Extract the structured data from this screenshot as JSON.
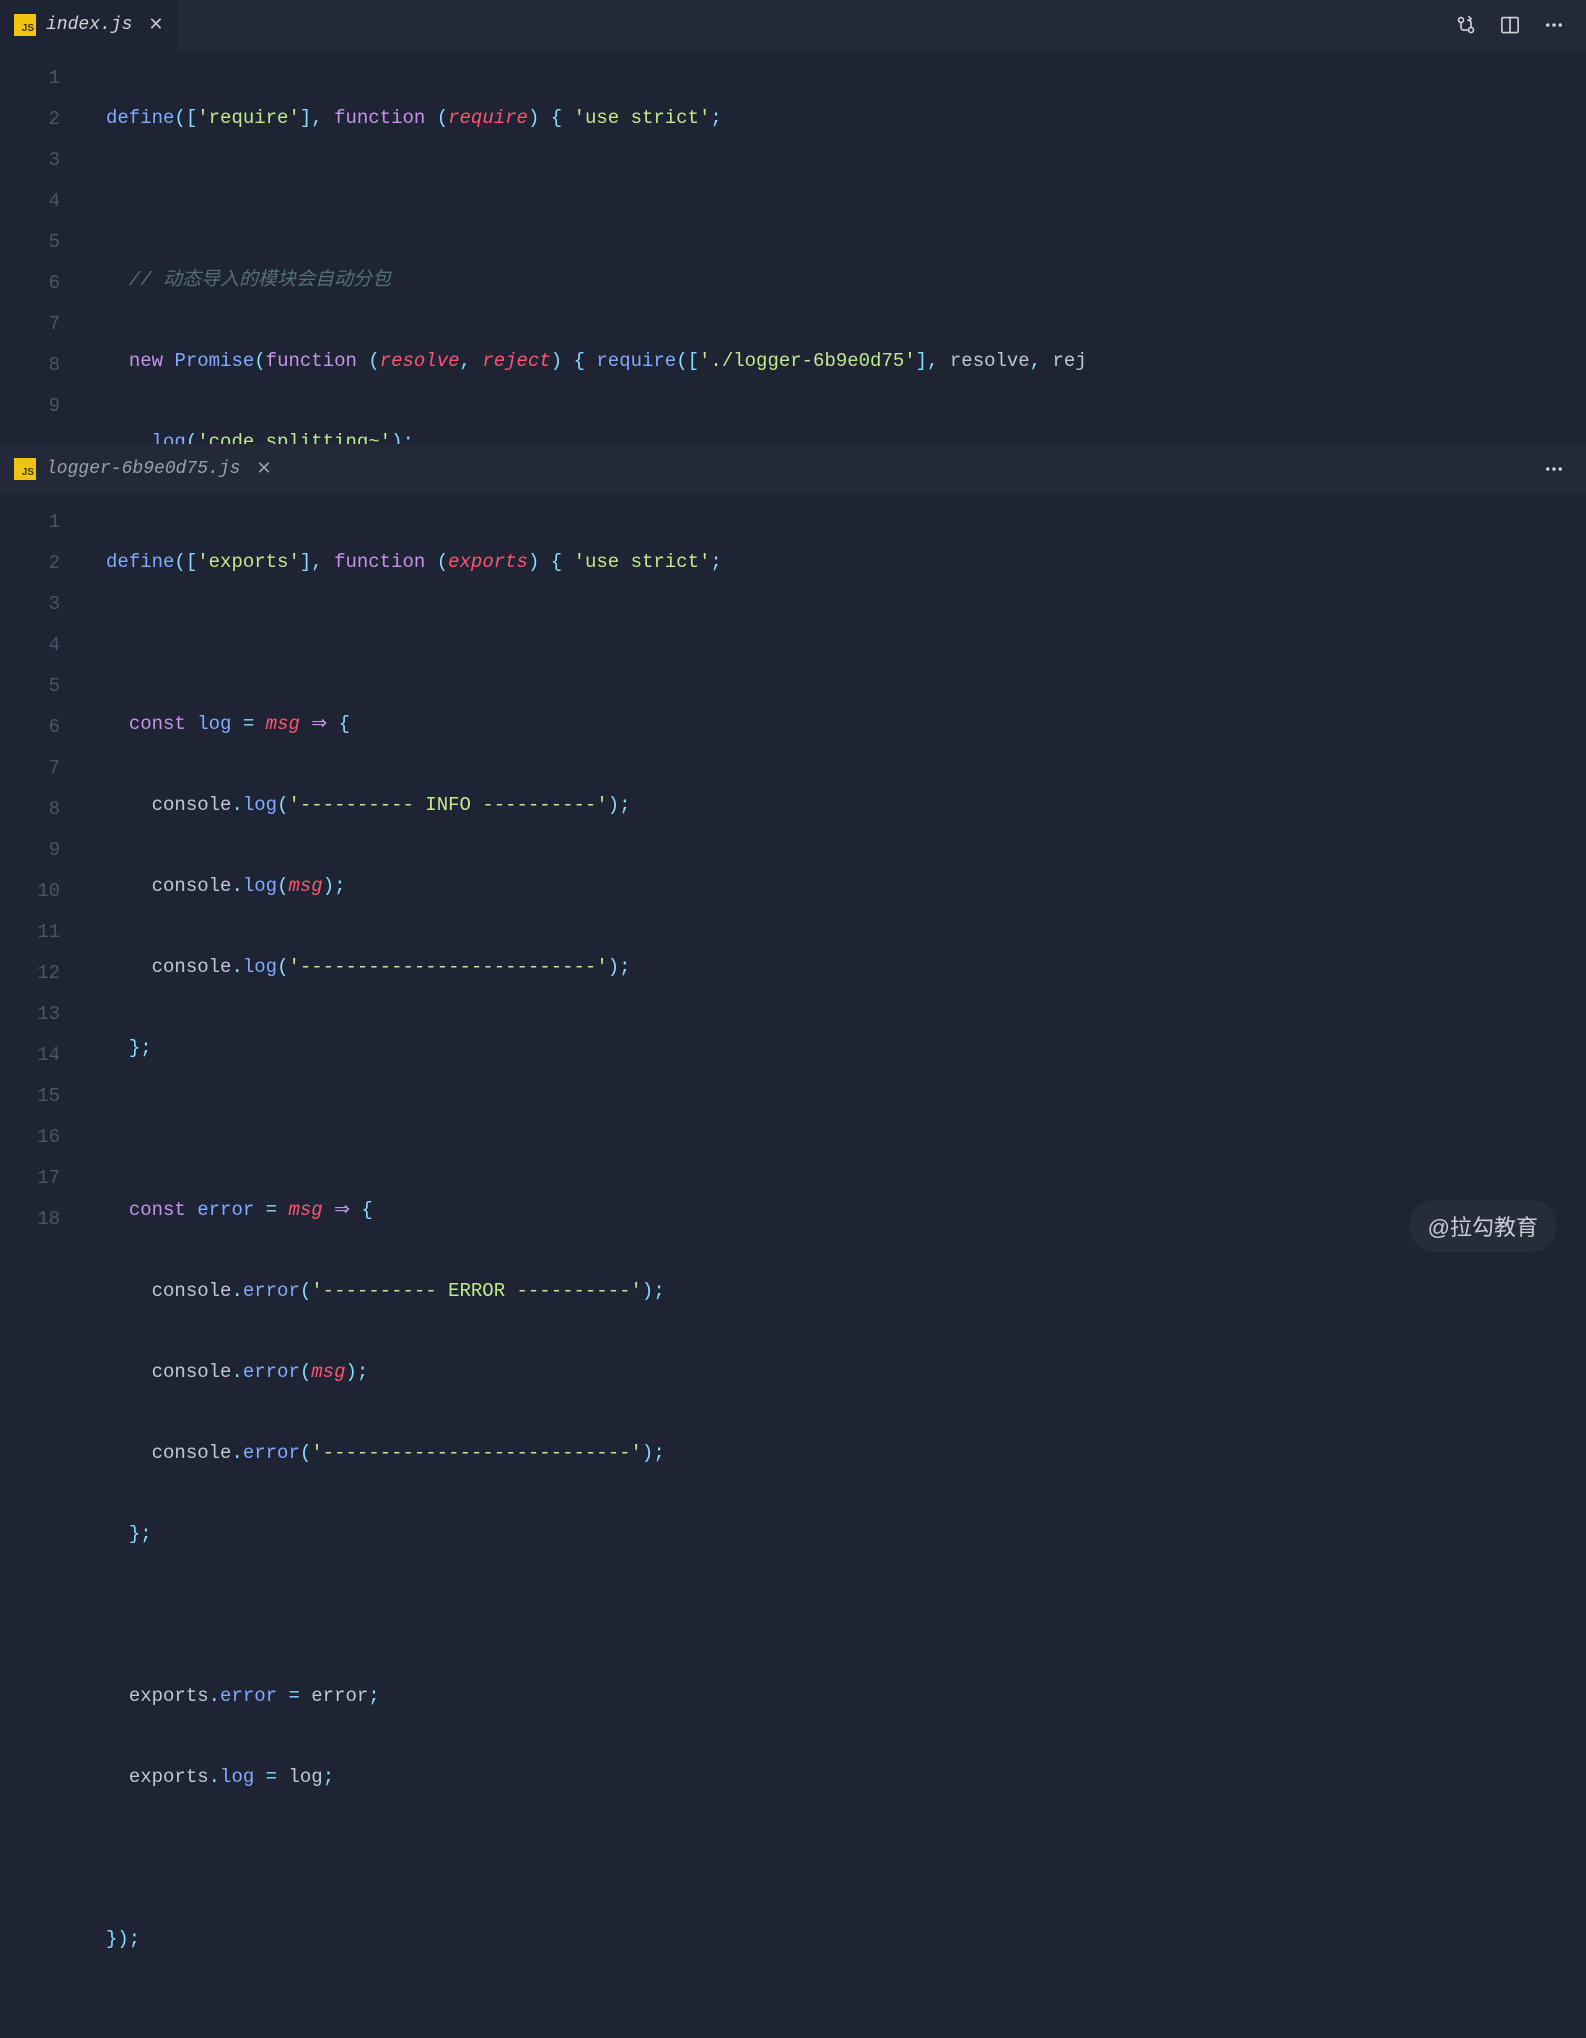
{
  "pane1": {
    "tab": {
      "filename": "index.js",
      "badge": "JS"
    },
    "actions": {
      "compare": "compare-changes-icon",
      "split": "split-editor-icon",
      "more": "more-icon"
    },
    "lines": [
      "1",
      "2",
      "3",
      "4",
      "5",
      "6",
      "7",
      "8",
      "9"
    ],
    "code": {
      "l1_define": "define",
      "l1_req_str": "'require'",
      "l1_function": "function",
      "l1_param": "require",
      "l1_usestrict": "'use strict'",
      "l3_comment": "// 动态导入的模块会自动分包",
      "l4_new": "new",
      "l4_promise": "Promise",
      "l4_function": "function",
      "l4_resolve": "resolve",
      "l4_reject": "reject",
      "l4_require": "require",
      "l4_path": "'./logger-6b9e0d75'",
      "l4_resolve2": "resolve",
      "l4_rej_tail": "rej",
      "l5_log": "log",
      "l5_msg": "'code splitting~'"
    }
  },
  "pane2": {
    "tab": {
      "filename": "logger-6b9e0d75.js",
      "badge": "JS"
    },
    "lines": [
      "1",
      "2",
      "3",
      "4",
      "5",
      "6",
      "7",
      "8",
      "9",
      "10",
      "11",
      "12",
      "13",
      "14",
      "15",
      "16",
      "17",
      "18"
    ],
    "code": {
      "l1_define": "define",
      "l1_exports_str": "'exports'",
      "l1_function": "function",
      "l1_param": "exports",
      "l1_usestrict": "'use strict'",
      "l3_const": "const",
      "l3_log": "log",
      "l3_msg": "msg",
      "l4_console": "console",
      "l4_log": "log",
      "l4_str": "'---------- INFO ----------'",
      "l5_msg": "msg",
      "l6_str": "'--------------------------'",
      "l9_const": "const",
      "l9_error": "error",
      "l9_msg": "msg",
      "l10_console": "console",
      "l10_error": "error",
      "l10_str": "'---------- ERROR ----------'",
      "l11_msg": "msg",
      "l12_str": "'---------------------------'",
      "l15_exports": "exports",
      "l15_error": "error",
      "l15_error2": "error",
      "l16_exports": "exports",
      "l16_log": "log",
      "l16_log2": "log"
    }
  },
  "watermark": "@拉勾教育"
}
